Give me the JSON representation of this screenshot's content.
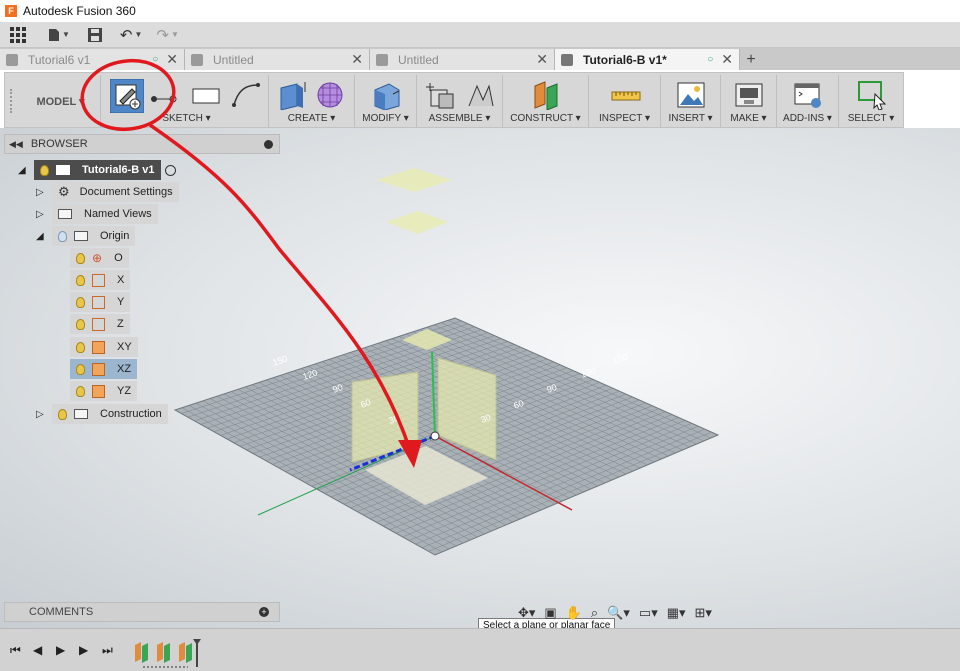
{
  "app": {
    "title": "Autodesk Fusion 360",
    "icon_letter": "F"
  },
  "tabs": [
    {
      "label": "Tutorial6 v1",
      "status": "○",
      "active": false
    },
    {
      "label": "Untitled",
      "status": "",
      "active": false
    },
    {
      "label": "Untitled",
      "status": "",
      "active": false
    },
    {
      "label": "Tutorial6-B v1*",
      "status": "○",
      "active": true
    }
  ],
  "toolbar": {
    "workspace": "MODEL ▾",
    "groups": [
      "SKETCH ▾",
      "CREATE ▾",
      "MODIFY ▾",
      "ASSEMBLE ▾",
      "CONSTRUCT ▾",
      "INSPECT ▾",
      "INSERT ▾",
      "MAKE ▾",
      "ADD-INS ▾",
      "SELECT ▾"
    ]
  },
  "browser": {
    "title": "BROWSER",
    "root": "Tutorial6-B v1",
    "document_settings": "Document Settings",
    "named_views": "Named Views",
    "origin": "Origin",
    "origin_items": [
      "O",
      "X",
      "Y",
      "Z",
      "XY",
      "XZ",
      "YZ"
    ],
    "selected_item": "XZ",
    "construction": "Construction"
  },
  "comments": {
    "title": "COMMENTS"
  },
  "viewport": {
    "tooltip": "Select a plane or planar face",
    "ruler_labels": [
      "150",
      "120",
      "90",
      "60",
      "30",
      "30",
      "60",
      "90",
      "120",
      "150"
    ],
    "annotation_color": "#e0191f"
  },
  "colors": {
    "plane_fill": "#e9ecb0",
    "grid": "#7d858c",
    "selection_blue": "#9cb6cf"
  }
}
